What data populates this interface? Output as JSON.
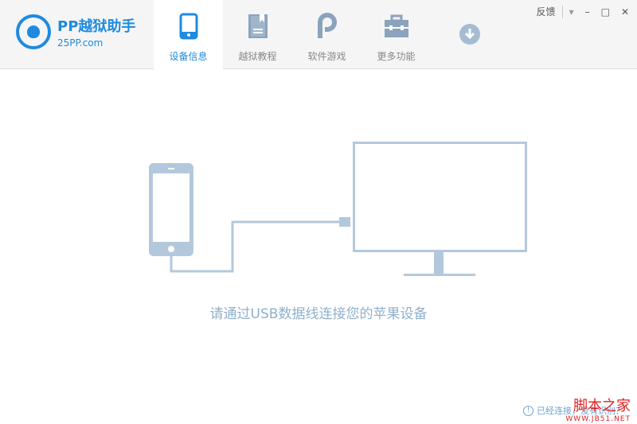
{
  "app": {
    "title": "PP越狱助手",
    "subtitle": "25PP.com"
  },
  "tabs": [
    {
      "label": "设备信息",
      "icon": "phone-icon",
      "active": true
    },
    {
      "label": "越狱教程",
      "icon": "book-icon"
    },
    {
      "label": "软件游戏",
      "icon": "pp-icon"
    },
    {
      "label": "更多功能",
      "icon": "toolbox-icon"
    }
  ],
  "window": {
    "feedback": "反馈",
    "menu": "▾",
    "minimize": "–",
    "maximize": "□",
    "close": "✕"
  },
  "main": {
    "message": "请通过USB数据线连接您的苹果设备",
    "status": "已经连接，没有识别？",
    "status_icon": "!"
  },
  "watermark": {
    "line1": "脚本之家",
    "line2": "WWW.JB51.NET"
  },
  "colors": {
    "accent": "#1e8be0",
    "illustration": "#b3c8dc"
  }
}
